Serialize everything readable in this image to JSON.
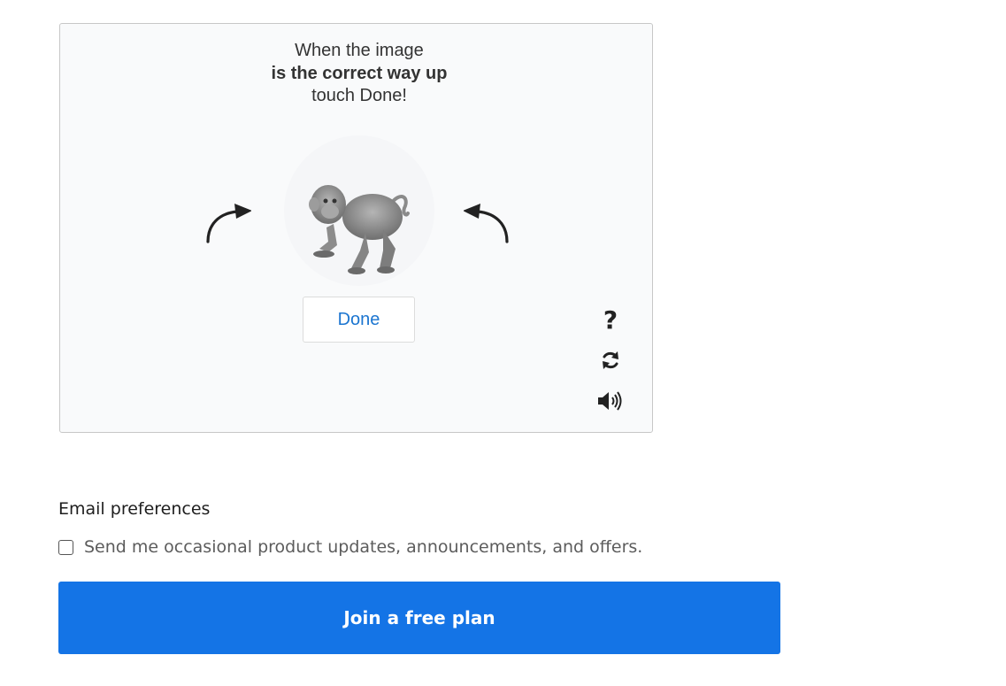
{
  "captcha": {
    "instruction_line1": "When the image",
    "instruction_line2": "is the correct way up",
    "instruction_line3": "touch Done!",
    "done_label": "Done",
    "help_label": "?",
    "image_subject": "monkey-image",
    "icons": {
      "rotate_left": "curved-arrow-left-icon",
      "rotate_right": "curved-arrow-right-icon",
      "refresh": "refresh-icon",
      "audio": "speaker-icon"
    }
  },
  "email_preferences": {
    "heading": "Email preferences",
    "optin_label": "Send me occasional product updates, announcements, and offers.",
    "optin_checked": false
  },
  "submit": {
    "label": "Join a free plan"
  },
  "colors": {
    "primary": "#1474e6",
    "link": "#1b75d0"
  }
}
